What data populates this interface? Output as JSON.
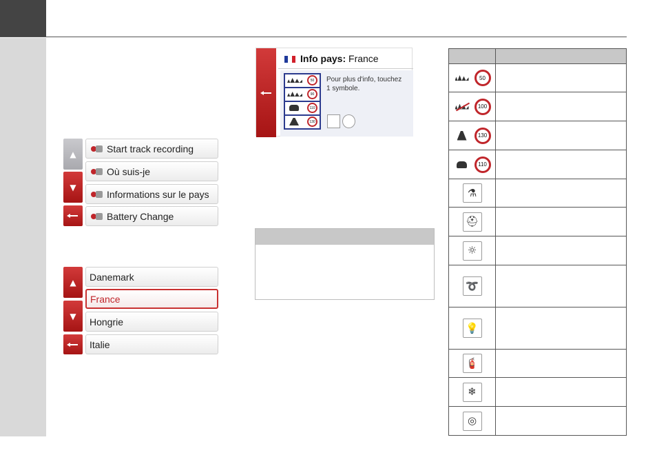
{
  "menu1": {
    "items": [
      {
        "label": "Start track recording"
      },
      {
        "label": "Où suis-je"
      },
      {
        "label": "Informations sur le pays"
      },
      {
        "label": "Battery Change"
      }
    ]
  },
  "menu2": {
    "items": [
      {
        "label": "Danemark"
      },
      {
        "label": "France"
      },
      {
        "label": "Hongrie"
      },
      {
        "label": "Italie"
      }
    ],
    "selected": "France"
  },
  "info_screen": {
    "title_bold": "Info pays:",
    "country": "France",
    "hint_line1": "Pour plus d'info, touchez",
    "hint_line2": "1 symbole.",
    "speed_limits": [
      "50",
      "90",
      "110",
      "130"
    ],
    "flag_colors": [
      "#1f3a9a",
      "#ffffff",
      "#d11f2a"
    ]
  },
  "symbols_table": {
    "speed_rows": [
      {
        "icon": "urban-sign",
        "limit": "50"
      },
      {
        "icon": "urban-end-sign",
        "limit": "100"
      },
      {
        "icon": "motorway-sign",
        "limit": "130"
      },
      {
        "icon": "car-sign",
        "limit": "110"
      }
    ],
    "symbol_rows": [
      {
        "icon": "alcohol-limit-icon",
        "glyph": "⚗"
      },
      {
        "icon": "safety-vest-icon",
        "glyph": "⛑"
      },
      {
        "icon": "daytime-lights-icon",
        "glyph": "☼"
      },
      {
        "icon": "tow-rope-icon",
        "glyph": "➰"
      },
      {
        "icon": "spare-bulb-icon",
        "glyph": "💡"
      },
      {
        "icon": "fire-extinguisher-icon",
        "glyph": "🧯"
      },
      {
        "icon": "snow-chains-icon",
        "glyph": "❄"
      },
      {
        "icon": "winter-tyres-icon",
        "glyph": "◎"
      }
    ]
  }
}
